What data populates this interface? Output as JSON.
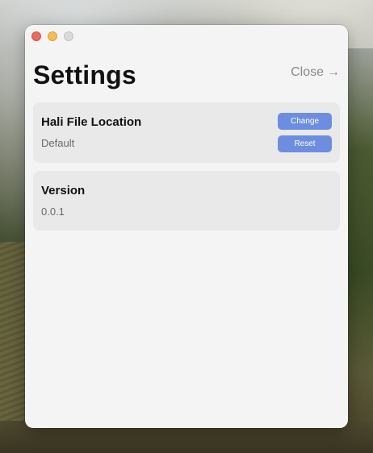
{
  "window": {
    "title": "Settings",
    "close_label": "Close",
    "close_arrow": "→"
  },
  "file_location": {
    "heading": "Hali File Location",
    "value": "Default",
    "change_label": "Change",
    "reset_label": "Reset"
  },
  "version": {
    "heading": "Version",
    "value": "0.0.1"
  },
  "colors": {
    "accent": "#6d8ee0",
    "card_bg": "#e9e9e9",
    "window_bg": "#f4f4f4"
  }
}
